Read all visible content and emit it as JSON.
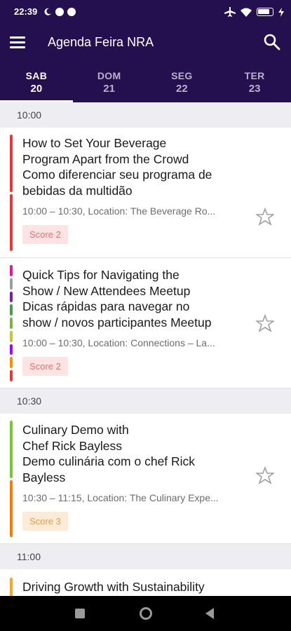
{
  "status_bar": {
    "time": "22:39",
    "icons": [
      "moon-icon",
      "p-icon",
      "p-icon",
      "airplane-icon",
      "wifi-icon",
      "battery-icon",
      "charging-icon"
    ]
  },
  "app_bar": {
    "title": "Agenda Feira NRA",
    "menu_icon": "menu-icon",
    "search_icon": "search-icon",
    "background": "#25104f"
  },
  "tabs": [
    {
      "day": "SAB",
      "date": "20",
      "active": true
    },
    {
      "day": "DOM",
      "date": "21",
      "active": false
    },
    {
      "day": "SEG",
      "date": "22",
      "active": false
    },
    {
      "day": "TER",
      "date": "23",
      "active": false
    }
  ],
  "schedule": {
    "groups": [
      {
        "time": "10:00",
        "sessions": [
          {
            "title_lines": [
              "How to Set Your Beverage",
              "Program Apart from the Crowd",
              "Como diferenciar seu programa de",
              "bebidas da multidão"
            ],
            "meta": "10:00 – 10:30,  Location: The Beverage Ro...",
            "score": "Score 2",
            "bar_colors": [
              "#e53935",
              "#e53935"
            ]
          },
          {
            "title_lines": [
              "Quick Tips for Navigating the",
              "Show / New Attendees Meetup",
              "Dicas rápidas para navegar no",
              "show / novos participantes Meetup"
            ],
            "meta": "10:00 – 10:30,  Location: Connections – La...",
            "score": "Score 2",
            "bar_colors": [
              "#d81b9a",
              "#9e9e9e",
              "#7b1fa2",
              "#43a047",
              "#7cb342",
              "#c0ca33",
              "#aa00ff",
              "#fb8c00",
              "#e53935"
            ]
          }
        ]
      },
      {
        "time": "10:30",
        "sessions": [
          {
            "title_lines": [
              "Culinary Demo with",
              "Chef Rick Bayless",
              "Demo culinária com o chef Rick",
              "Bayless"
            ],
            "meta": "10:30 – 11:15,  Location: The Culinary Expe...",
            "score": "Score 3",
            "bar_colors": [
              "#76c82e",
              "#f57c00"
            ]
          }
        ]
      },
      {
        "time": "11:00",
        "sessions": [
          {
            "title_lines": [
              "Driving Growth with Sustainability"
            ],
            "meta": "",
            "score": "",
            "bar_colors": [
              "#f5a623"
            ]
          }
        ]
      }
    ]
  },
  "score_styles": {
    "Score 2": {
      "bg": "#fde3e3",
      "fg": "#e57373"
    },
    "Score 3": {
      "bg": "#fdebd7",
      "fg": "#f09a3e"
    }
  },
  "nav_bar": {
    "buttons": [
      "recents-button",
      "home-button",
      "back-button"
    ]
  }
}
